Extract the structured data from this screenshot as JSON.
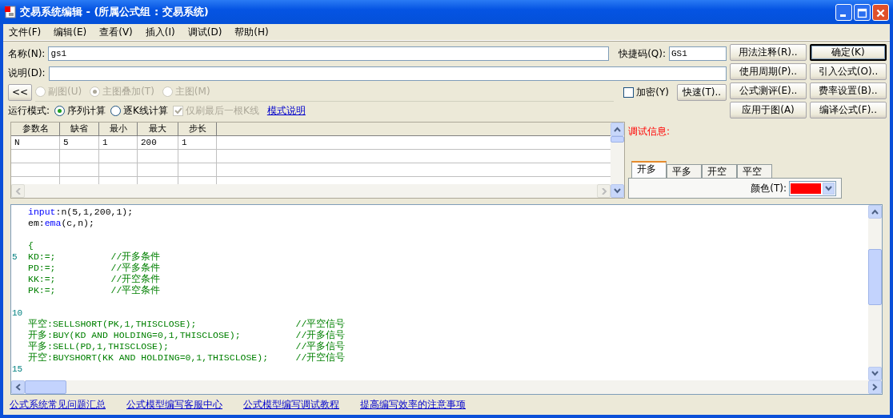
{
  "window": {
    "title": "交易系统编辑 - (所属公式组 : 交易系统)"
  },
  "menu": [
    {
      "label": "文件(F)"
    },
    {
      "label": "编辑(E)"
    },
    {
      "label": "查看(V)"
    },
    {
      "label": "插入(I)"
    },
    {
      "label": "调试(D)"
    },
    {
      "label": "帮助(H)"
    }
  ],
  "form": {
    "name_label": "名称(N):",
    "name_value": "gs1",
    "shortcut_label": "快捷码(Q):",
    "shortcut_value": "GS1",
    "desc_label": "说明(D):"
  },
  "collapse_button": "<<",
  "chart_types": [
    {
      "label": "副图(U)",
      "selected": false,
      "disabled": true
    },
    {
      "label": "主图叠加(T)",
      "selected": true,
      "disabled": true
    },
    {
      "label": "主图(M)",
      "selected": false,
      "disabled": true
    }
  ],
  "encrypt": {
    "label": "加密(Y)",
    "checked": false
  },
  "quick_button": "快速(T)..",
  "run_mode": {
    "label": "运行模式:",
    "options": [
      {
        "label": "序列计算",
        "selected": true
      },
      {
        "label": "逐K线计算",
        "selected": false
      }
    ],
    "refresh_last": {
      "label": "仅刷最后一根K线",
      "checked": true,
      "disabled": true
    },
    "help_link": "模式说明"
  },
  "buttons": [
    {
      "label": "用法注释(R)..",
      "default": false
    },
    {
      "label": "确定(K)",
      "default": true
    },
    {
      "label": "使用周期(P)..",
      "default": false
    },
    {
      "label": "引入公式(O)..",
      "default": false
    },
    {
      "label": "公式测评(E)..",
      "default": false
    },
    {
      "label": "费率设置(B)..",
      "default": false
    },
    {
      "label": "应用于图(A)",
      "default": false
    },
    {
      "label": "编译公式(F)..",
      "default": false
    }
  ],
  "params": {
    "columns": [
      "参数名",
      "缺省",
      "最小",
      "最大",
      "步长"
    ],
    "rows": [
      [
        "N",
        "5",
        "1",
        "200",
        "1"
      ]
    ]
  },
  "debug": {
    "label": "调试信息:"
  },
  "signal_tabs": [
    {
      "label": "开多",
      "selected": true
    },
    {
      "label": "平多",
      "selected": false
    },
    {
      "label": "开空",
      "selected": false
    },
    {
      "label": "平空",
      "selected": false
    }
  ],
  "color": {
    "label": "颜色(T):",
    "color": "#ff0000"
  },
  "editor": {
    "lines": [
      {
        "kind": "code",
        "segments": [
          {
            "kind": "keyword",
            "text": "input"
          },
          {
            "kind": "plain",
            "text": ":n(5,1,200,1);"
          }
        ]
      },
      {
        "kind": "code",
        "segments": [
          {
            "kind": "plain",
            "text": "em:"
          },
          {
            "kind": "keyword",
            "text": "ema"
          },
          {
            "kind": "plain",
            "text": "(c,n);"
          }
        ]
      },
      {
        "kind": "blank"
      },
      {
        "kind": "code",
        "segments": [
          {
            "kind": "statement",
            "text": "{"
          }
        ]
      },
      {
        "kind": "code",
        "number": "5",
        "segments": [
          {
            "kind": "statement",
            "text": "KD:=;          //开多条件"
          }
        ]
      },
      {
        "kind": "code",
        "segments": [
          {
            "kind": "statement",
            "text": "PD:=;          //平多条件"
          }
        ]
      },
      {
        "kind": "code",
        "segments": [
          {
            "kind": "statement",
            "text": "KK:=;          //开空条件"
          }
        ]
      },
      {
        "kind": "code",
        "segments": [
          {
            "kind": "statement",
            "text": "PK:=;          //平空条件"
          }
        ]
      },
      {
        "kind": "blank"
      },
      {
        "kind": "blank",
        "number": "10"
      },
      {
        "kind": "code",
        "segments": [
          {
            "kind": "statement",
            "text": "平空:SELLSHORT(PK,1,THISCLOSE);                  //平空信号"
          }
        ]
      },
      {
        "kind": "code",
        "segments": [
          {
            "kind": "statement",
            "text": "开多:BUY(KD AND HOLDING=0,1,THISCLOSE);          //开多信号"
          }
        ]
      },
      {
        "kind": "code",
        "segments": [
          {
            "kind": "statement",
            "text": "平多:SELL(PD,1,THISCLOSE);                       //平多信号"
          }
        ]
      },
      {
        "kind": "code",
        "segments": [
          {
            "kind": "statement",
            "text": "开空:BUYSHORT(KK AND HOLDING=0,1,THISCLOSE);     //开空信号"
          }
        ]
      },
      {
        "kind": "blank",
        "number": "15"
      }
    ]
  },
  "links": [
    "公式系统常见问题汇总",
    "公式模型编写客服中心",
    "公式模型编写调试教程",
    "提高编写效率的注意事项"
  ]
}
